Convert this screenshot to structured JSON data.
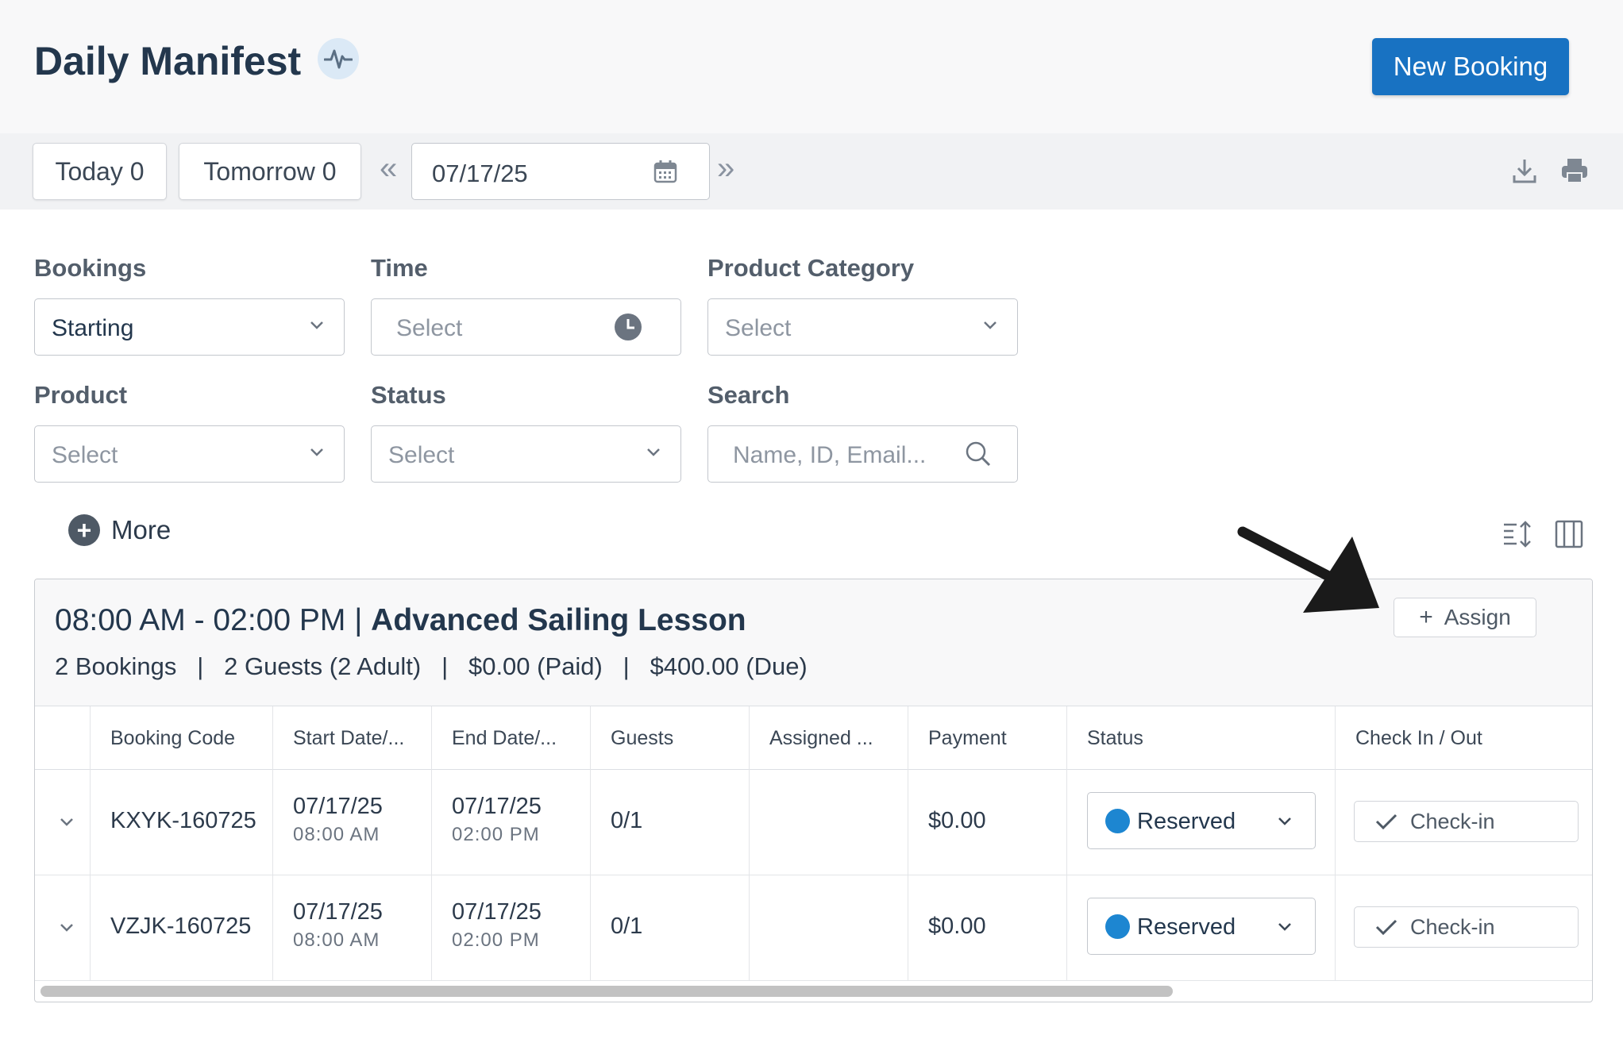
{
  "header": {
    "title": "Daily Manifest",
    "activity_icon": "activity-pulse-icon",
    "new_booking_label": "New Booking",
    "brand_color": "#1872c2"
  },
  "toolbar": {
    "today_label": "Today 0",
    "tomorrow_label": "Tomorrow 0",
    "prev_glyph": "«",
    "next_glyph": "»",
    "date_value": "07/17/25",
    "icons": [
      "calendar-icon",
      "download-icon",
      "print-icon"
    ]
  },
  "filters": {
    "bookings": {
      "label": "Bookings",
      "value": "Starting"
    },
    "time": {
      "label": "Time",
      "placeholder": "Select"
    },
    "product_category": {
      "label": "Product Category",
      "placeholder": "Select"
    },
    "product": {
      "label": "Product",
      "placeholder": "Select"
    },
    "status": {
      "label": "Status",
      "placeholder": "Select"
    },
    "search": {
      "label": "Search",
      "placeholder": "Name, ID, Email..."
    },
    "more_label": "More"
  },
  "view_icons": [
    "sort-rows-icon",
    "columns-icon"
  ],
  "slot": {
    "time_range": "08:00 AM - 02:00 PM | ",
    "product_name": "Advanced Sailing Lesson",
    "summary": "2 Bookings   |   2 Guests (2 Adult)   |   $0.00 (Paid)   |   $400.00 (Due)",
    "assign_label": "Assign"
  },
  "table": {
    "columns": [
      "Booking Code",
      "Start Date/...",
      "End Date/...",
      "Guests",
      "Assigned ...",
      "Payment",
      "Status",
      "Check In / Out"
    ],
    "rows": [
      {
        "code": "KXYK-160725",
        "start_date": "07/17/25",
        "start_time": "08:00 AM",
        "end_date": "07/17/25",
        "end_time": "02:00 PM",
        "guests": "0/1",
        "assigned": "",
        "payment": "$0.00",
        "status": "Reserved",
        "action": "Check-in"
      },
      {
        "code": "VZJK-160725",
        "start_date": "07/17/25",
        "start_time": "08:00 AM",
        "end_date": "07/17/25",
        "end_time": "02:00 PM",
        "guests": "0/1",
        "assigned": "",
        "payment": "$0.00",
        "status": "Reserved",
        "action": "Check-in"
      }
    ],
    "status_color": "#1d86d1"
  }
}
